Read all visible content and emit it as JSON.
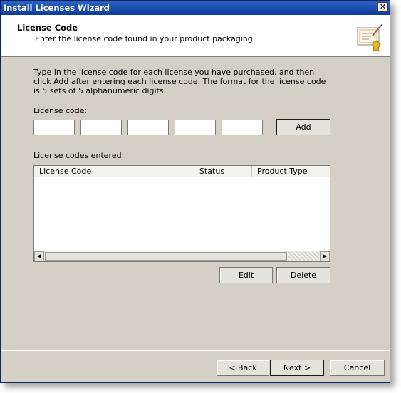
{
  "window": {
    "title": "Install Licenses Wizard",
    "close_glyph": "✕"
  },
  "header": {
    "title": "License Code",
    "subtitle": "Enter the license code found in your product packaging.",
    "icon": "certificate-icon"
  },
  "instructions": "Type in the license code for each license you have purchased, and then click Add after entering each license code. The format for the license code is 5 sets of 5 alphanumeric digits.",
  "license_code": {
    "label": "License code:",
    "segments": [
      "",
      "",
      "",
      "",
      ""
    ]
  },
  "add_label": "Add",
  "entered": {
    "label": "License codes entered:",
    "columns": [
      "License Code",
      "Status",
      "Product Type"
    ],
    "rows": []
  },
  "list_buttons": {
    "edit": "Edit",
    "delete": "Delete"
  },
  "footer": {
    "back": "< Back",
    "next": "Next >",
    "cancel": "Cancel"
  },
  "colors": {
    "titlebar": "#0a3d99",
    "dialog": "#d4d0c8"
  }
}
